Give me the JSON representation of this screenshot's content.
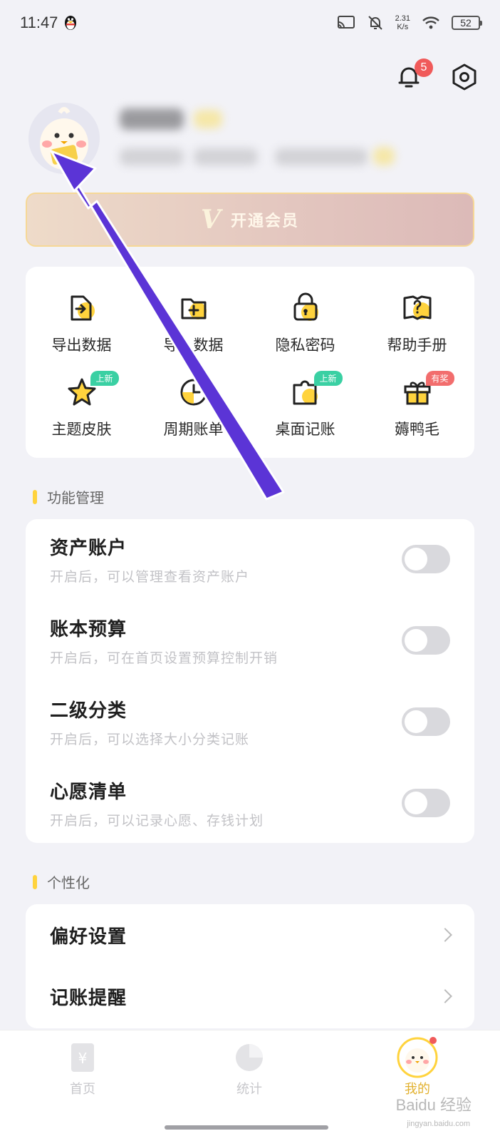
{
  "status_bar": {
    "time": "11:47",
    "net_speed_value": "2.31",
    "net_speed_unit": "K/s",
    "battery": "52"
  },
  "header": {
    "notification_count": "5"
  },
  "vip": {
    "mark": "V",
    "label": "开通会员"
  },
  "tools": [
    {
      "label": "导出数据",
      "icon": "export-icon"
    },
    {
      "label": "导入数据",
      "icon": "import-icon"
    },
    {
      "label": "隐私密码",
      "icon": "lock-icon"
    },
    {
      "label": "帮助手册",
      "icon": "help-book-icon"
    },
    {
      "label": "主题皮肤",
      "icon": "star-icon",
      "tag": "上新"
    },
    {
      "label": "周期账单",
      "icon": "clock-icon"
    },
    {
      "label": "桌面记账",
      "icon": "widget-icon",
      "tag": "上新"
    },
    {
      "label": "薅鸭毛",
      "icon": "gift-icon",
      "tag": "有奖"
    }
  ],
  "sections": {
    "features_title": "功能管理",
    "personal_title": "个性化"
  },
  "features": [
    {
      "title": "资产账户",
      "desc": "开启后，可以管理查看资产账户",
      "enabled": false
    },
    {
      "title": "账本预算",
      "desc": "开启后，可在首页设置预算控制开销",
      "enabled": false
    },
    {
      "title": "二级分类",
      "desc": "开启后，可以选择大小分类记账",
      "enabled": false
    },
    {
      "title": "心愿清单",
      "desc": "开启后，可以记录心愿、存钱计划",
      "enabled": false
    }
  ],
  "personal": [
    {
      "label": "偏好设置"
    },
    {
      "label": "记账提醒"
    }
  ],
  "bottom_nav": [
    {
      "label": "首页",
      "icon": "bill-icon"
    },
    {
      "label": "统计",
      "icon": "pie-chart-icon"
    },
    {
      "label": "我的",
      "icon": "avatar-icon",
      "active": true
    }
  ],
  "watermark": {
    "main": "Baidu 经验",
    "sub": "jingyan.baidu.com"
  },
  "colors": {
    "accent": "#ffd33d",
    "annotation_arrow": "#5b34d6",
    "badge": "#f05a5a"
  }
}
